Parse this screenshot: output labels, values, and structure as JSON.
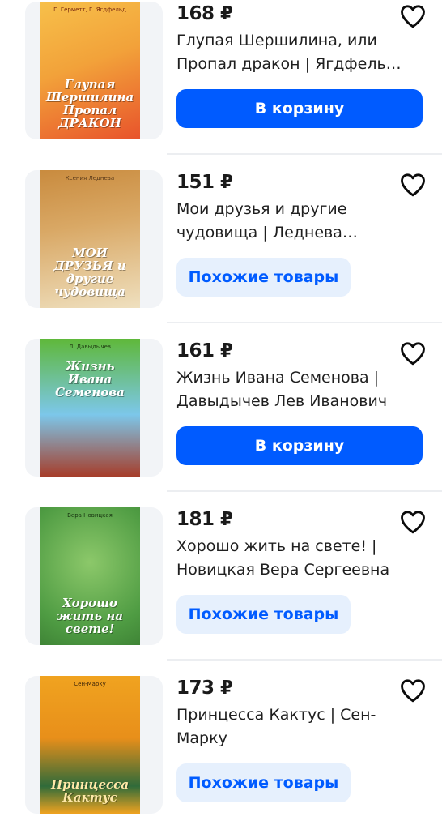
{
  "products": [
    {
      "price": "168 ₽",
      "title": "Глупая Шершилина, или Пропал дракон | Ягдфельд Гурий Борисович",
      "button": "В корзину",
      "button_type": "primary",
      "cover_author": "Г. Герметт, Г. Ягдфельд",
      "cover_title": "Глупая Шершилина Пропал ДРАКОН",
      "cover_colors": [
        "#f7b733",
        "#e8532b"
      ]
    },
    {
      "price": "151 ₽",
      "title": "Мои друзья и другие чудовища | Леднева Светлана",
      "button": "Похожие товары",
      "button_type": "secondary",
      "cover_author": "Ксения Леднева",
      "cover_title": "МОИ ДРУЗЬЯ и другие чудовища",
      "cover_colors": [
        "#c98b3e",
        "#e9d3a6"
      ]
    },
    {
      "price": "161 ₽",
      "title": "Жизнь Ивана Семенова | Давыдычев Лев Иванович",
      "button": "В корзину",
      "button_type": "primary",
      "cover_author": "Л. Давыдычев",
      "cover_title": "Жизнь Ивана Семенова",
      "cover_colors": [
        "#5fb83a",
        "#6fb5e8"
      ]
    },
    {
      "price": "181 ₽",
      "title": "Хорошо жить на свете! | Новицкая Вера Сергеевна",
      "button": "Похожие товары",
      "button_type": "secondary",
      "cover_author": "Вера Новицкая",
      "cover_title": "Хорошо жить на свете!",
      "cover_colors": [
        "#4f9c43",
        "#8cc86a"
      ]
    },
    {
      "price": "173 ₽",
      "title": "Принцесса Кактус | Сен-Марку",
      "button": "Похожие товары",
      "button_type": "secondary",
      "cover_author": "Сен-Марку",
      "cover_title": "Принцесса Кактус",
      "cover_colors": [
        "#f0a320",
        "#2f6b3a"
      ]
    }
  ],
  "icons": {
    "favorite": "heart-outline-icon"
  },
  "colors": {
    "accent": "#005bff",
    "secondary_bg": "#e6f0fd",
    "text": "#1f1f1f"
  }
}
